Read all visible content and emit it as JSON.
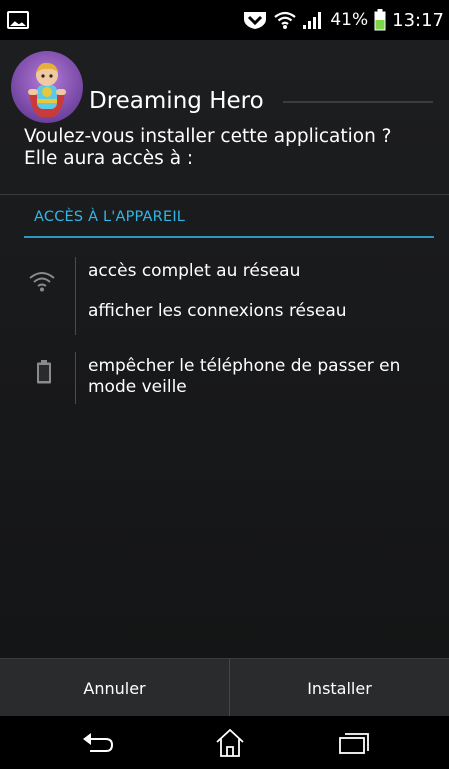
{
  "status_bar": {
    "battery_percent": "41%",
    "time": "13:17",
    "icons": [
      "gallery-icon",
      "notification-shield-icon",
      "wifi-icon",
      "signal-icon",
      "battery-icon"
    ]
  },
  "app": {
    "name": "Dreaming Hero",
    "icon": "app-icon-hero"
  },
  "prompt": {
    "line1": "Voulez-vous installer cette application ?",
    "line2": "Elle aura accès à :"
  },
  "permissions": {
    "section_title": "ACCÈS À L'APPAREIL",
    "groups": [
      {
        "icon": "wifi-icon",
        "items": [
          "accès complet au réseau",
          "afficher les connexions réseau"
        ]
      },
      {
        "icon": "battery-icon",
        "items": [
          "empêcher le téléphone de passer en",
          "mode veille"
        ]
      }
    ]
  },
  "buttons": {
    "cancel": "Annuler",
    "install": "Installer"
  },
  "navigation": [
    "back-icon",
    "home-icon",
    "recent-apps-icon"
  ],
  "colors": {
    "accent": "#33b5e5",
    "background": "#1b1c1e",
    "button_bar": "#2a2b2d",
    "battery_green": "#7bd64a"
  }
}
